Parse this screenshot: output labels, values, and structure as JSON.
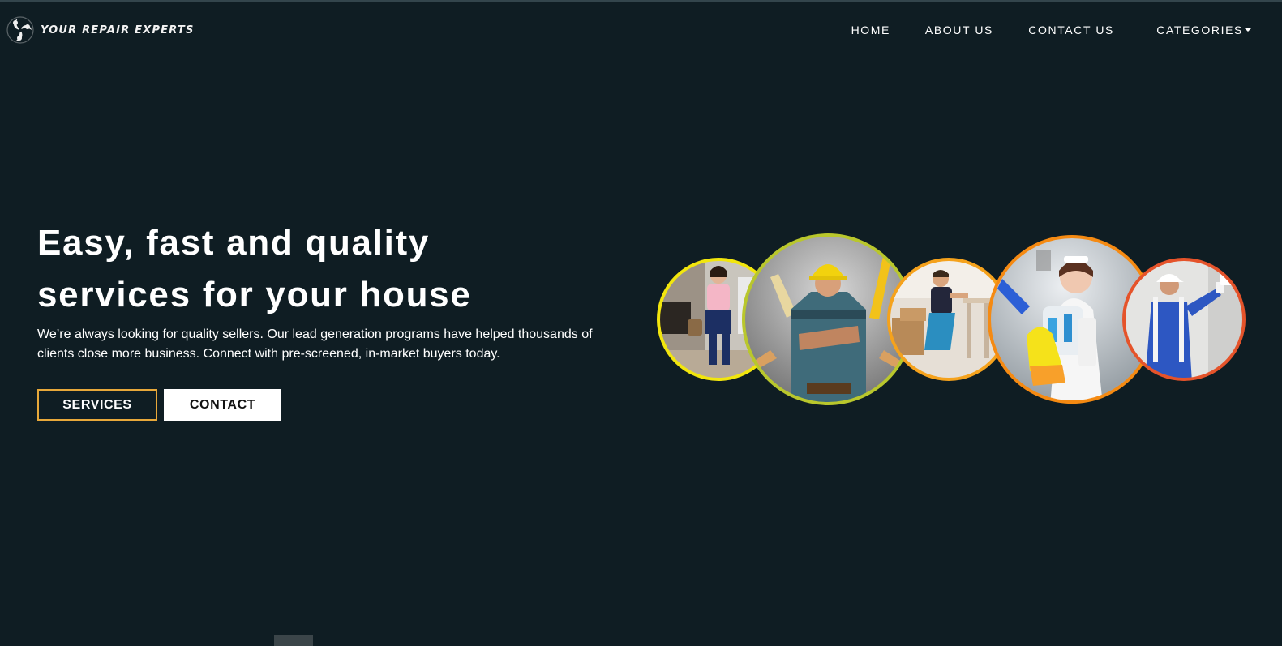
{
  "brand": {
    "name": "YOUR REPAIR EXPERTS",
    "logo_icon": "swirl-logo-icon"
  },
  "nav": {
    "items": [
      {
        "label": "HOME"
      },
      {
        "label": "ABOUT US"
      },
      {
        "label": "CONTACT US"
      },
      {
        "label": "CATEGORIES",
        "dropdown": true
      }
    ]
  },
  "hero": {
    "title_line1": "Easy, fast and quality",
    "title_line2": "services for your house",
    "text": "We’re always looking for quality sellers. Our lead generation programs have helped thousands of clients close more business. Connect with pre-screened, in-market buyers today.",
    "services_button": "SERVICES",
    "contact_button": "CONTACT"
  },
  "collage": {
    "photos": [
      {
        "subject": "housekeeper-photo",
        "ring_color": "#f2e60d"
      },
      {
        "subject": "handyman-photo",
        "ring_color": "#b9c72c"
      },
      {
        "subject": "furniture-assembly-photo",
        "ring_color": "#f5a21c"
      },
      {
        "subject": "cleaning-lady-photo",
        "ring_color": "#f58a12"
      },
      {
        "subject": "painter-photo",
        "ring_color": "#e5532a"
      }
    ]
  },
  "colors": {
    "background": "#0f1d23",
    "accent": "#e7a83a",
    "text": "#ffffff"
  }
}
